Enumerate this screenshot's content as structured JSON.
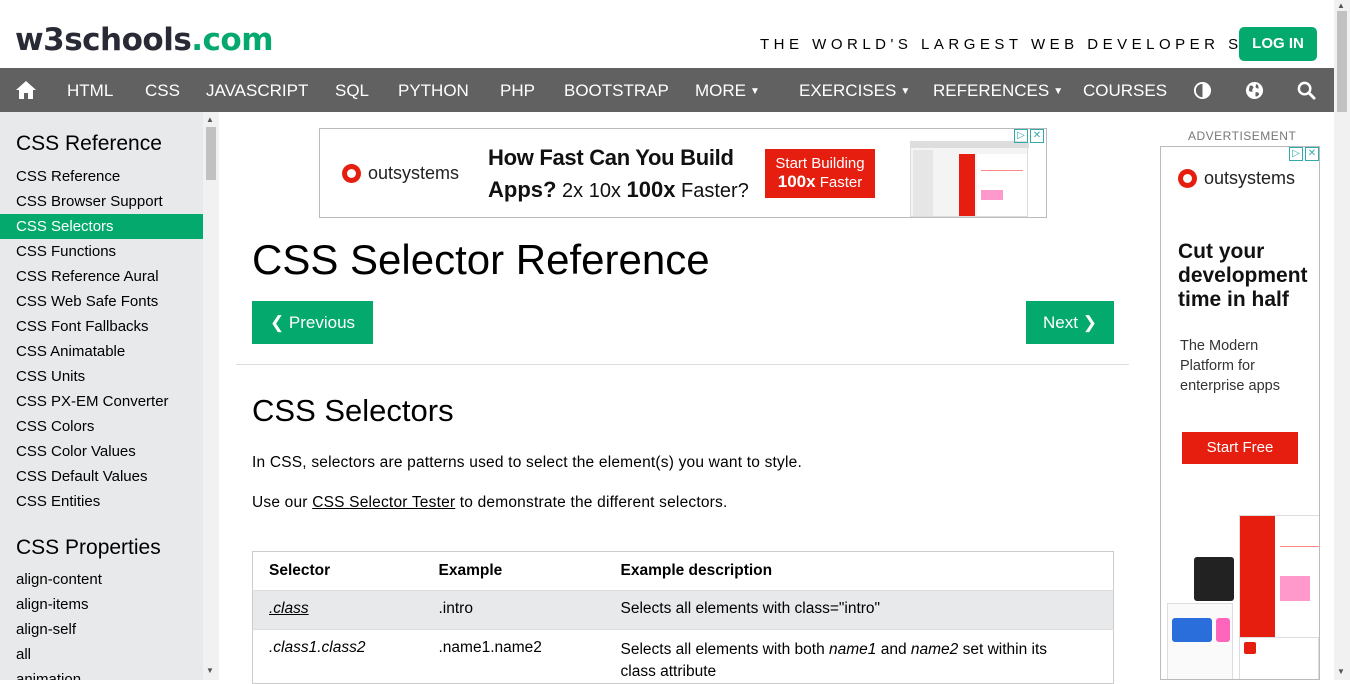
{
  "header": {
    "logo_main": "w3schools",
    "logo_suffix": ".com",
    "tagline": "THE WORLD'S LARGEST WEB DEVELOPER SITE",
    "login_label": "LOG IN"
  },
  "nav": {
    "home_icon": "home-icon",
    "items": [
      "HTML",
      "CSS",
      "JAVASCRIPT",
      "SQL",
      "PYTHON",
      "PHP",
      "BOOTSTRAP",
      "MORE",
      "EXERCISES",
      "REFERENCES",
      "COURSES"
    ],
    "right_icons": [
      "contrast-icon",
      "globe-icon",
      "search-icon"
    ]
  },
  "sidebar": {
    "heading1": "CSS Reference",
    "items": [
      "CSS Reference",
      "CSS Browser Support",
      "CSS Selectors",
      "CSS Functions",
      "CSS Reference Aural",
      "CSS Web Safe Fonts",
      "CSS Font Fallbacks",
      "CSS Animatable",
      "CSS Units",
      "CSS PX-EM Converter",
      "CSS Colors",
      "CSS Color Values",
      "CSS Default Values",
      "CSS Entities"
    ],
    "active_item": "CSS Selectors",
    "heading2": "CSS Properties",
    "props": [
      "align-content",
      "align-items",
      "align-self",
      "all",
      "animation"
    ]
  },
  "ad_top": {
    "brand": "outsystems",
    "headline_line1": "How Fast Can You Build",
    "headline_line2a": "Apps?",
    "headline_line2b": " 2x 10x ",
    "headline_line2c": "100x",
    "headline_line2d": " Faster?",
    "cta_line1": "Start Building",
    "cta_line2a": "100x",
    "cta_line2b": " Faster"
  },
  "main": {
    "title": "CSS Selector Reference",
    "prev_label": "❮ Previous",
    "next_label": "Next ❯",
    "section_title": "CSS Selectors",
    "para1": "In CSS, selectors are patterns used to select the element(s) you want to style.",
    "para2_before": "Use our ",
    "para2_link": "CSS Selector Tester",
    "para2_after": " to demonstrate the different selectors."
  },
  "table": {
    "headers": [
      "Selector",
      "Example",
      "Example description"
    ],
    "rows": [
      {
        "selector": ".class",
        "example": ".intro",
        "description": "Selects all elements with class=\"intro\""
      },
      {
        "selector": ".class1.class2",
        "example": ".name1.name2",
        "desc_a": "Selects all elements with both ",
        "desc_b": "name1",
        "desc_c": " and ",
        "desc_d": "name2",
        "desc_e": " set within its",
        "desc_line2": "class attribute"
      }
    ]
  },
  "ad_right": {
    "label": "ADVERTISEMENT",
    "brand": "outsystems",
    "headline": "Cut your development time in half",
    "sub": "The Modern Platform for enterprise apps",
    "cta": "Start Free"
  },
  "colors": {
    "brand_green": "#04AA6D",
    "nav_gray": "#616161",
    "sidebar_bg": "#E7E9EB",
    "ad_red": "#E61E0F"
  }
}
